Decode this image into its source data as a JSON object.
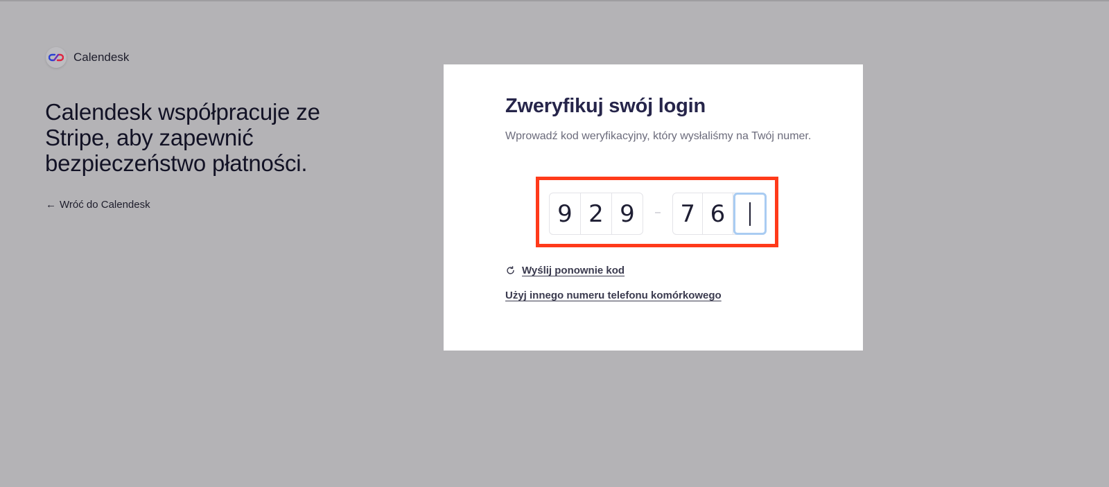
{
  "brand": {
    "name": "Calendesk"
  },
  "left_panel": {
    "headline": "Calendesk współpracuje ze Stripe, aby zapewnić bezpieczeństwo płatności.",
    "back_link": "Wróć do Calendesk",
    "back_arrow": "←"
  },
  "card": {
    "title": "Zweryfikuj swój login",
    "subtitle": "Wprowadź kod weryfikacyjny, który wysłaliśmy na Twój numer.",
    "code": {
      "group1": [
        "9",
        "2",
        "9"
      ],
      "group2": [
        "7",
        "6",
        ""
      ]
    },
    "resend_label": "Wyślij ponownie kod",
    "other_number_label": "Użyj innego numeru telefonu komórkowego"
  },
  "colors": {
    "background": "#b4b3b6",
    "highlight_border": "#ff3a1a",
    "active_cell_border": "#a9ccf2",
    "title": "#26254a"
  }
}
